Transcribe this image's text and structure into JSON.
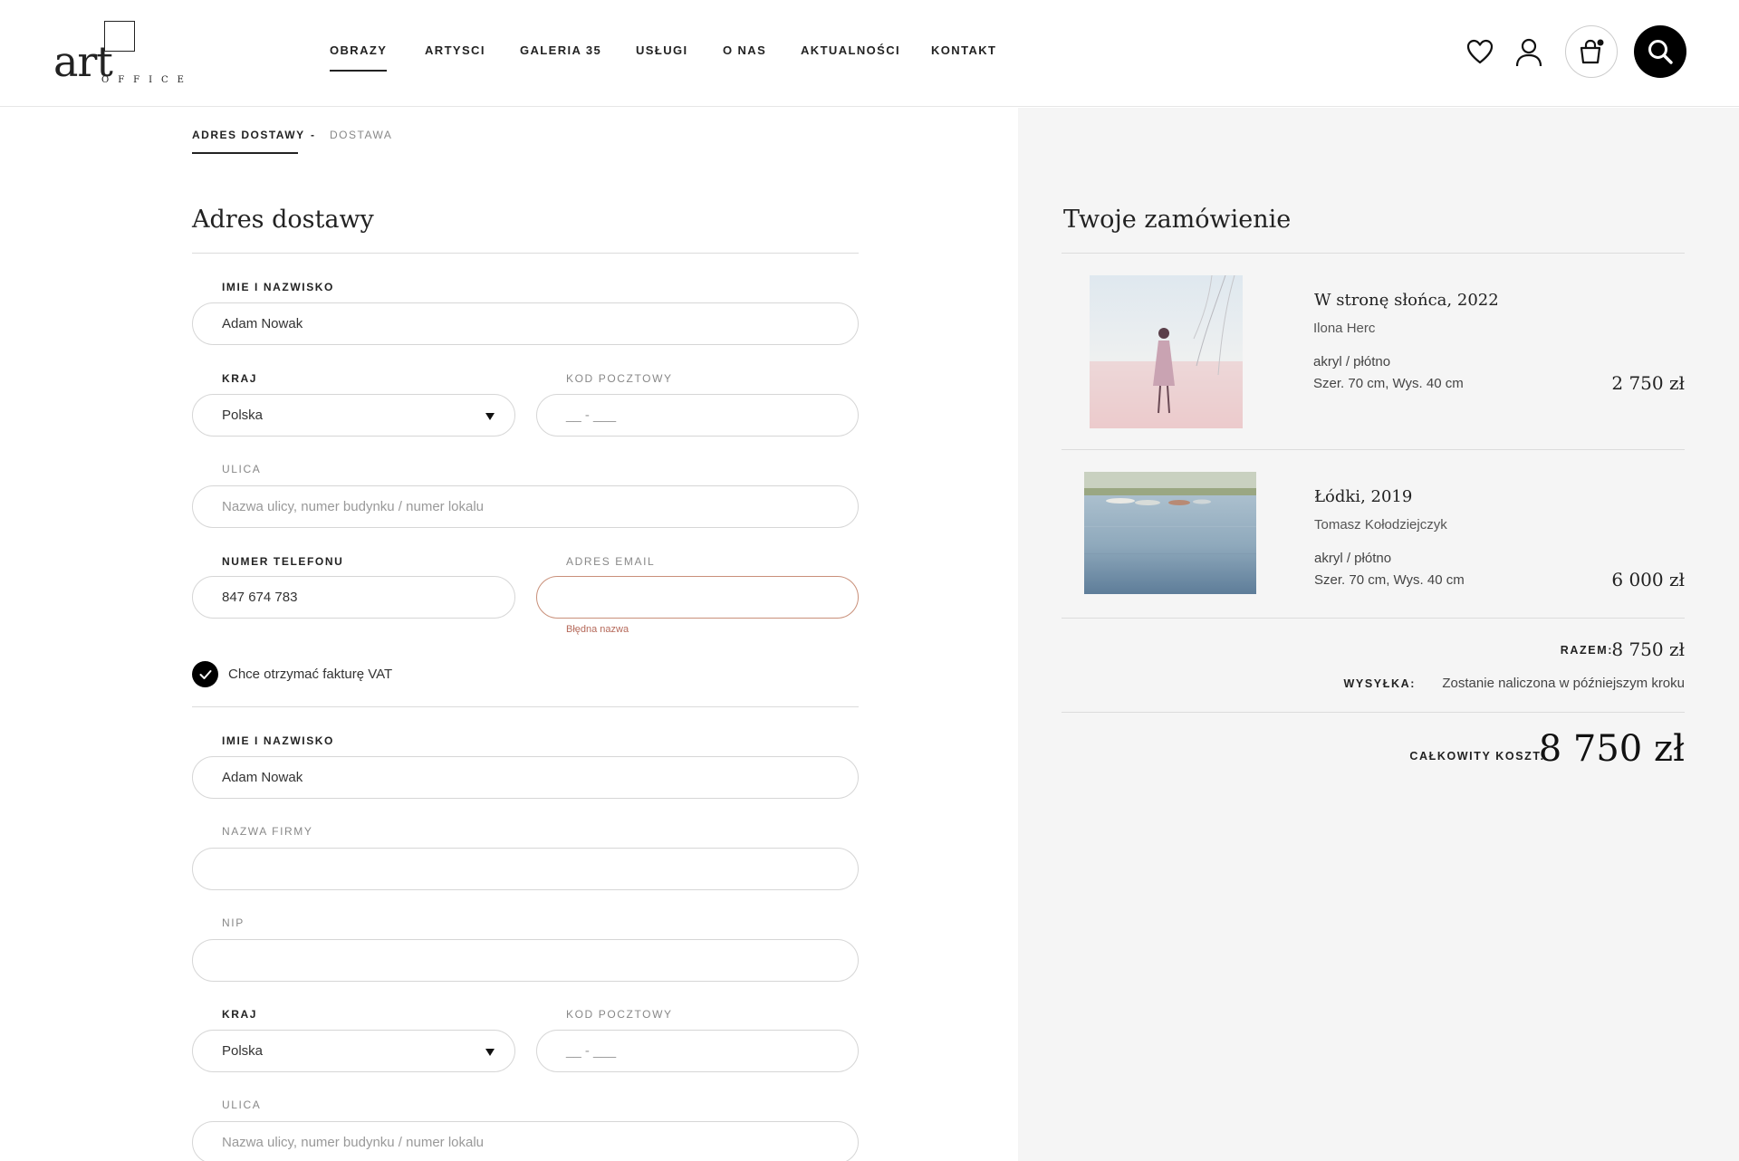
{
  "brand": {
    "logo_text": "art",
    "logo_sub": "OFFICE"
  },
  "nav": {
    "items": [
      {
        "label": "OBRAZY",
        "active": true
      },
      {
        "label": "ARTYSCI"
      },
      {
        "label": "GALERIA 35"
      },
      {
        "label": "USŁUGI"
      },
      {
        "label": "O NAS"
      },
      {
        "label": "AKTUALNOŚCI"
      },
      {
        "label": "KONTAKT"
      }
    ]
  },
  "header_icons": [
    "heart-icon",
    "user-icon",
    "cart-icon",
    "search-icon"
  ],
  "breadcrumb": {
    "step1": "ADRES DOSTAWY",
    "sep": "-",
    "step2": "DOSTAWA"
  },
  "shipping": {
    "heading": "Adres dostawy",
    "name_label": "IMIE I NAZWISKO",
    "name_value": "Adam Nowak",
    "country_label": "KRAJ",
    "country_value": "Polska",
    "postal_label": "KOD POCZTOWY",
    "postal_placeholder": "__ - ___",
    "street_label": "ULICA",
    "street_placeholder": "Nazwa ulicy, numer budynku / numer lokalu",
    "phone_label": "NUMER TELEFONU",
    "phone_value": "847 674 783",
    "email_label": "ADRES EMAIL",
    "email_value": "",
    "email_error": "Błędna nazwa",
    "vat_label": "Chce otrzymać fakturę VAT",
    "vat_checked": true
  },
  "invoice": {
    "name_label": "IMIE I NAZWISKO",
    "name_value": "Adam Nowak",
    "company_label": "NAZWA FIRMY",
    "company_value": "",
    "nip_label": "NIP",
    "nip_value": "",
    "country_label": "KRAJ",
    "country_value": "Polska",
    "postal_label": "KOD POCZTOWY",
    "postal_placeholder": "__ - ___",
    "street_label": "ULICA",
    "street_placeholder": "Nazwa ulicy, numer budynku / numer lokalu"
  },
  "order": {
    "heading": "Twoje zamówienie",
    "items": [
      {
        "title": "W stronę słońca, 2022",
        "artist": "Ilona Herc",
        "medium": "akryl / płótno",
        "dims": "Szer. 70 cm, Wys. 40 cm",
        "price": "2 750 zł"
      },
      {
        "title": "Łódki, 2019",
        "artist": "Tomasz Kołodziejczyk",
        "medium": "akryl / płótno",
        "dims": "Szer. 70 cm, Wys. 40 cm",
        "price": "6 000 zł"
      }
    ],
    "subtotal_label": "RAZEM:",
    "subtotal_value": "8 750 zł",
    "shipping_label": "WYSYŁKA:",
    "shipping_value": "Zostanie naliczona w późniejszym kroku",
    "total_label": "CAŁKOWITY KOSZT:",
    "total_value": "8 750 zł"
  },
  "colors": {
    "accent": "#000000",
    "panel_bg": "#f5f5f5",
    "error": "#b5695a"
  }
}
